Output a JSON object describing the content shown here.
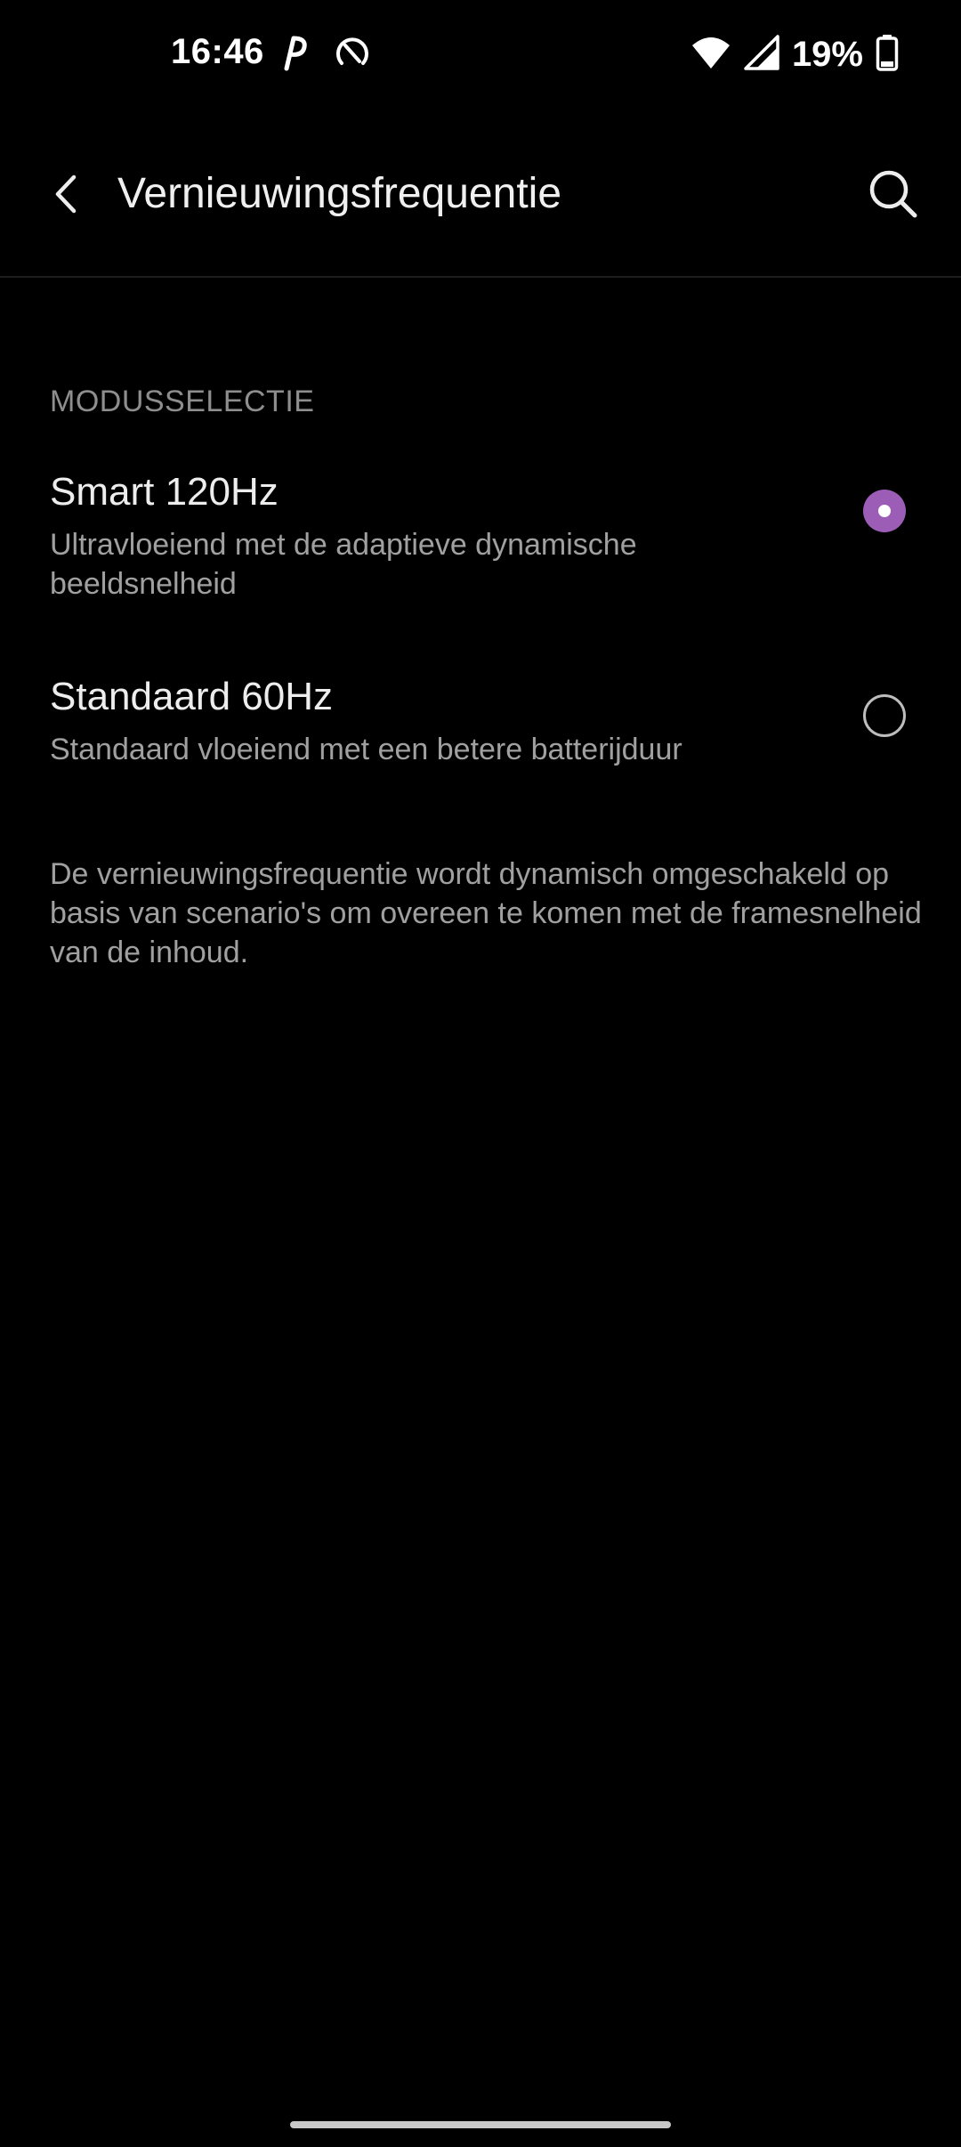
{
  "status_bar": {
    "time": "16:46",
    "battery_percent": "19%",
    "icons_left": [
      "p-app-icon",
      "sync-circle-icon"
    ],
    "icons_right": [
      "wifi-icon",
      "signal-icon",
      "battery-icon"
    ]
  },
  "header": {
    "title": "Vernieuwingsfrequentie",
    "back_icon": "chevron-left-icon",
    "search_icon": "search-icon"
  },
  "section": {
    "header": "MODUSSELECTIE"
  },
  "options": [
    {
      "title": "Smart 120Hz",
      "summary": "Ultravloeiend met de adaptieve dynamische beeldsnelheid",
      "selected": true
    },
    {
      "title": "Standaard 60Hz",
      "summary": "Standaard vloeiend met een betere batterijduur",
      "selected": false
    }
  ],
  "footer": {
    "text": "De vernieuwingsfrequentie wordt dynamisch omgeschakeld op basis van scenario's om overeen te komen met de framesnelheid van de inhoud."
  },
  "colors": {
    "background": "#000000",
    "accent": "#9C5DB7",
    "primary_text": "#EDEDED",
    "secondary_text": "#A0A0A0"
  }
}
